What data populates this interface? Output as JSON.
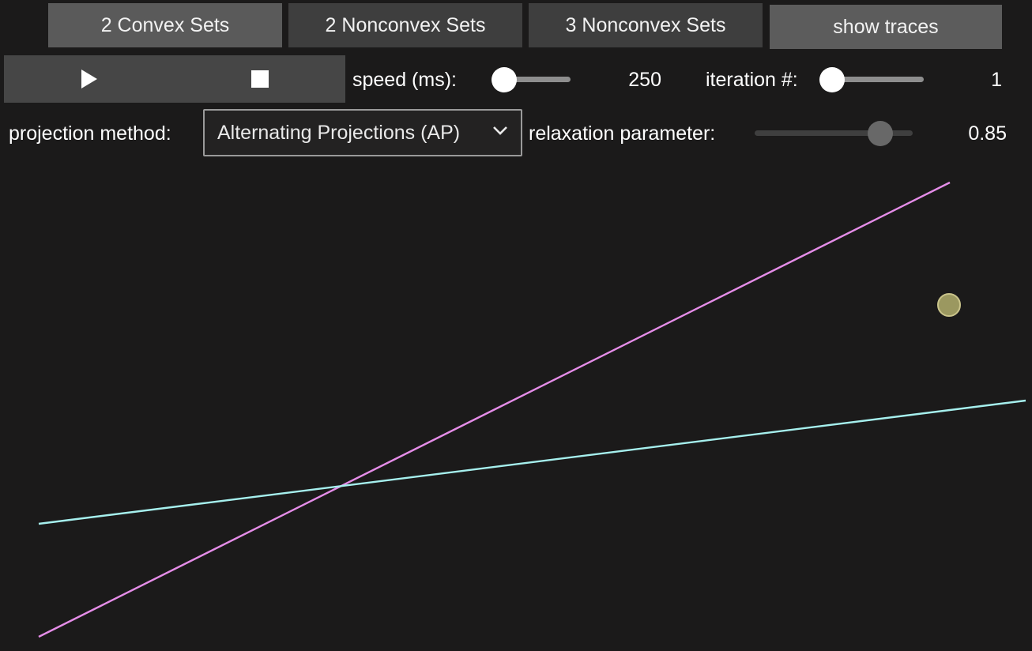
{
  "presets": {
    "convex2": "2 Convex Sets",
    "nonconvex2": "2 Nonconvex Sets",
    "nonconvex3": "3 Nonconvex Sets",
    "traces": "show traces"
  },
  "controls": {
    "speed_label": "speed (ms):",
    "speed_value": "250",
    "speed_fraction": 0.0,
    "iteration_label": "iteration #:",
    "iteration_value": "1",
    "iteration_fraction": 0.0,
    "method_label": "projection method:",
    "method_selected": "Alternating Projections (AP)",
    "relaxation_label": "relaxation parameter:",
    "relaxation_value": "0.85",
    "relaxation_fraction": 0.85
  },
  "icons": {
    "play": "play-icon",
    "stop": "stop-icon",
    "dropdown": "chevron-down-icon"
  },
  "colors": {
    "background": "#1b1a1a",
    "set_a_line": "#e58de8",
    "set_b_line": "#a6f0ee",
    "point": "#9b9860"
  }
}
